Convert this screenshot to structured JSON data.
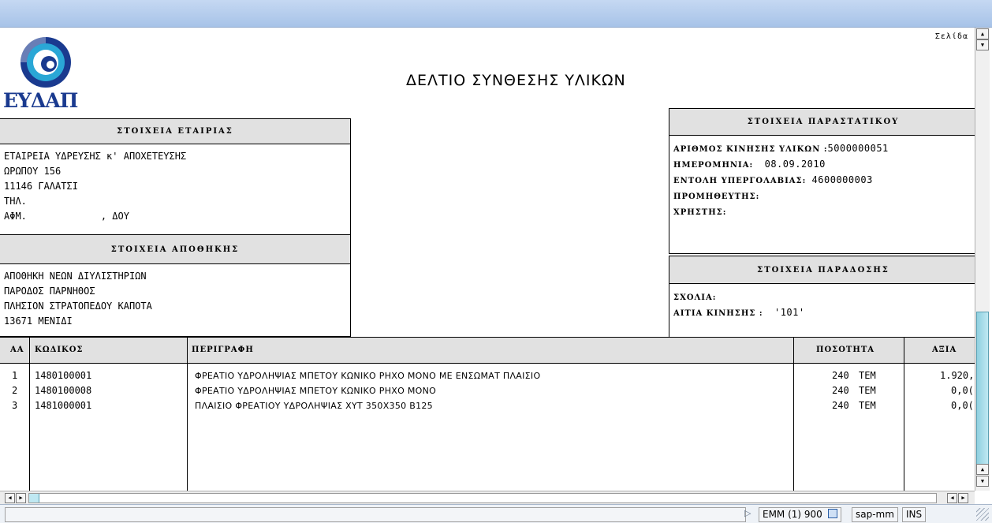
{
  "document": {
    "title": "ΔΕΛΤΙΟ ΣΥΝΘΕΣΗΣ ΥΛΙΚΩΝ",
    "page_label": "Σελίδα",
    "logo_text": "ΕΥΔΑΠ"
  },
  "company": {
    "header": "ΣΤΟΙΧΕΙΑ ΕΤΑΙΡΙΑΣ",
    "lines": [
      "ΕΤΑΙΡΕΙΑ ΥΔΡΕΥΣΗΣ κ' ΑΠΟΧΕΤΕΥΣΗΣ",
      "ΩΡΩΠΟΥ 156",
      "11146 ΓΑΛΑΤΣΙ",
      "ΤΗΛ.",
      "ΑΦΜ.             , ΔΟΥ"
    ]
  },
  "warehouse": {
    "header": "ΣΤΟΙΧΕΙΑ ΑΠΟΘΗΚΗΣ",
    "lines": [
      "ΑΠΟΘΗΚΗ ΝΕΩΝ ΔΙΥΛΙΣΤΗΡΙΩΝ",
      "ΠΑΡΟΔΟΣ ΠΑΡΝΗΘΟΣ",
      "ΠΛΗΣΙΟΝ ΣΤΡΑΤΟΠΕΔΟΥ ΚΑΠΟΤΑ",
      "13671 ΜΕΝΙΔΙ"
    ]
  },
  "voucher": {
    "header": "ΣΤΟΙΧΕΙΑ ΠΑΡΑΣΤΑΤΙΚΟΥ",
    "fields": [
      {
        "label": "ΑΡΙΘΜΟΣ ΚΙΝΗΣΗΣ ΥΛΙΚΩΝ :",
        "value": "5000000051"
      },
      {
        "label": "ΗΜΕΡΟΜΗΝΙΑ:",
        "value": "08.09.2010"
      },
      {
        "label": "ΕΝΤΟΛΗ ΥΠΕΡΓΟΛΑΒΙΑΣ:",
        "value": "4600000003"
      },
      {
        "label": "ΠΡΟΜΗΘΕΥΤΗΣ:",
        "value": ""
      },
      {
        "label": "ΧΡΗΣΤΗΣ:",
        "value": ""
      }
    ]
  },
  "delivery": {
    "header": "ΣΤΟΙΧΕΙΑ ΠΑΡΑΔΟΣΗΣ",
    "fields": [
      {
        "label": "ΣΧΟΛΙΑ:",
        "value": ""
      },
      {
        "label": "ΑΙΤΙΑ ΚΙΝΗΣΗΣ :",
        "value": "'101'"
      }
    ]
  },
  "table": {
    "columns": [
      "ΑΑ",
      "ΚΩΔΙΚΟΣ",
      "ΠΕΡΙΓΡΑΦΗ",
      "ΠΟΣΟΤΗΤΑ",
      "ΑΞΙΑ"
    ],
    "rows": [
      {
        "aa": "1",
        "code": "1480100001",
        "desc": "ΦΡΕΑΤΙΟ ΥΔΡΟΛΗΨΙΑΣ ΜΠΕΤΟΥ ΚΩΝΙΚΟ ΡΗΧΟ ΜΟΝΟ ΜΕ ΕΝΣΩΜΑΤ ΠΛΑΙΣΙΟ",
        "qty": "240",
        "unit": "ΤΕΜ",
        "value": "1.920,"
      },
      {
        "aa": "2",
        "code": "1480100008",
        "desc": "ΦΡΕΑΤΙΟ ΥΔΡΟΛΗΨΙΑΣ ΜΠΕΤΟΥ ΚΩΝΙΚΟ ΡΗΧΟ ΜΟΝΟ",
        "qty": "240",
        "unit": "ΤΕΜ",
        "value": "0,0("
      },
      {
        "aa": "3",
        "code": "1481000001",
        "desc": "ΠΛΑΙΣΙΟ ΦΡΕΑΤΙΟΥ ΥΔΡΟΛΗΨΙΑΣ ΧΥΤ 350Χ350 Β125",
        "qty": "240",
        "unit": "ΤΕΜ",
        "value": "0,0("
      }
    ]
  },
  "statusbar": {
    "system": "EMM (1) 900",
    "server": "sap-mm",
    "mode": "INS"
  },
  "colors": {
    "titlebar": "#b6cdee",
    "header_bg": "#e1e1e1",
    "scroll_thumb": "#a8dfec",
    "logo_blue": "#1a3a8f",
    "logo_cyan": "#2aa7d6"
  }
}
